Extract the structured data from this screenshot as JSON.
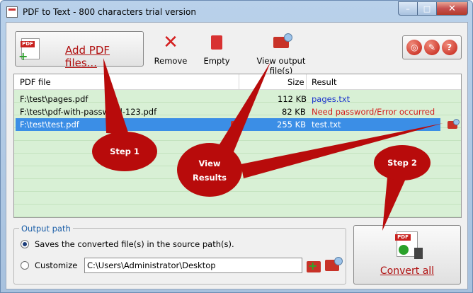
{
  "window": {
    "title": "PDF to Text - 800 characters trial version"
  },
  "caption": {
    "minimize": "–",
    "maximize": "□",
    "close": "✕"
  },
  "toolbar": {
    "add_label": "Add PDF files...",
    "add_icon_tag": "PDF",
    "remove_label": "Remove",
    "empty_label": "Empty",
    "view_output_label": "View output file(s)",
    "remove_icon": "red-x-icon",
    "empty_icon": "recycle-bin-icon",
    "view_output_icon": "folder-magnifier-icon"
  },
  "utility_buttons": {
    "web": "◎",
    "register": "✎",
    "help": "?"
  },
  "grid": {
    "columns": [
      "PDF file",
      "Size",
      "Result"
    ],
    "rows": [
      {
        "file": "F:\\test\\pages.pdf",
        "size": "112 KB",
        "result": "pages.txt",
        "result_color": "#1a33cc"
      },
      {
        "file": "F:\\test\\pdf-with-password-123.pdf",
        "size": "82 KB",
        "result": "Need password/Error occurred",
        "result_color": "#d41c1c"
      },
      {
        "file": "F:\\test\\test.pdf",
        "size": "255 KB",
        "result": "test.txt",
        "result_color": "#ffffff",
        "selected": true
      }
    ]
  },
  "output": {
    "legend": "Output path",
    "option_source": "Saves the converted file(s) in the source path(s).",
    "option_custom": "Customize",
    "custom_path": "C:\\Users\\Administrator\\Desktop"
  },
  "convert": {
    "label": "Convert all",
    "icon_tag": "PDF"
  },
  "callouts": {
    "step1": "Step 1",
    "view_results": [
      "View",
      "Results"
    ],
    "step2": "Step 2"
  },
  "colors": {
    "callout_red": "#b80b0b",
    "link_red": "#b01010",
    "selection_blue": "#3b8ee6",
    "grid_green": "#d8f0d5"
  }
}
